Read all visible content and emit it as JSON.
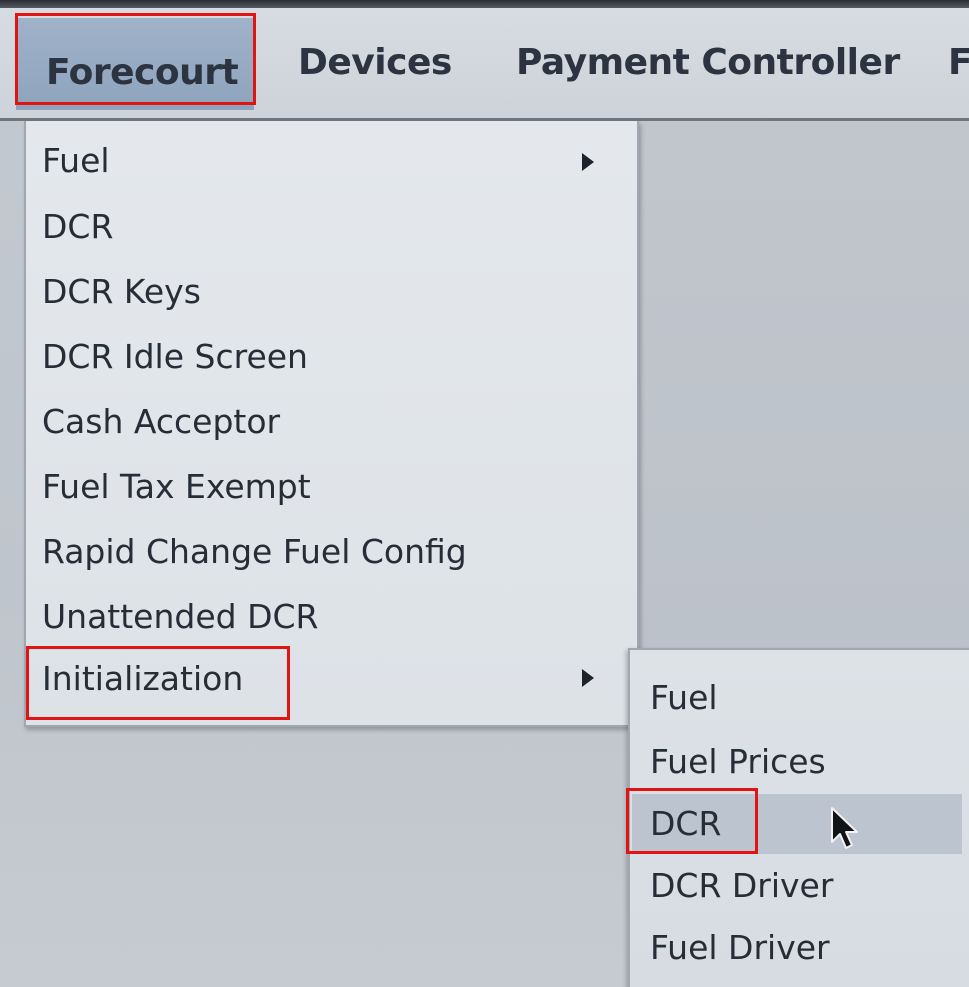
{
  "menubar": {
    "items": [
      {
        "label": "Forecourt"
      },
      {
        "label": "Devices"
      },
      {
        "label": "Payment Controller"
      },
      {
        "label": "F"
      }
    ]
  },
  "forecourt_menu": {
    "items": [
      {
        "label": "Fuel"
      },
      {
        "label": "DCR"
      },
      {
        "label": "DCR Keys"
      },
      {
        "label": "DCR Idle Screen"
      },
      {
        "label": "Cash Acceptor"
      },
      {
        "label": "Fuel Tax Exempt"
      },
      {
        "label": "Rapid Change Fuel Config"
      },
      {
        "label": "Unattended DCR"
      },
      {
        "label": "Initialization"
      }
    ]
  },
  "initialization_submenu": {
    "items": [
      {
        "label": "Fuel"
      },
      {
        "label": "Fuel Prices"
      },
      {
        "label": "DCR"
      },
      {
        "label": "DCR Driver"
      },
      {
        "label": "Fuel Driver"
      }
    ]
  },
  "colors": {
    "annotation_highlight": "#e11414",
    "menubar_active": "#9fb2c9",
    "submenu_hover": "#bcc5cf"
  },
  "icons": [
    "submenu-arrow-icon",
    "mouse-pointer-icon"
  ]
}
